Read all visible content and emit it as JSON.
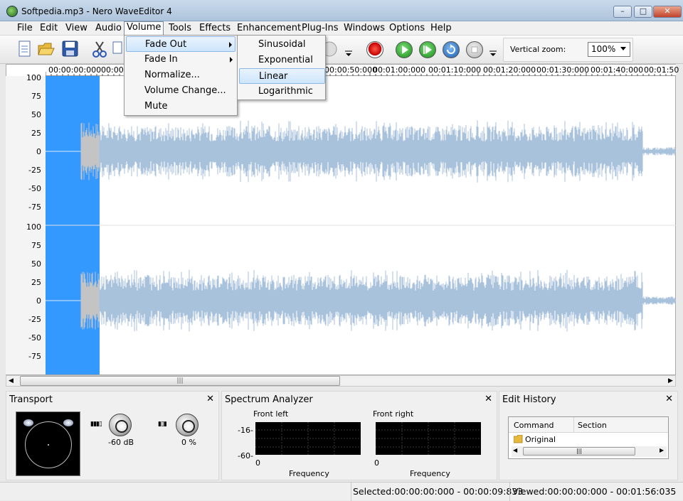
{
  "window": {
    "title": "Softpedia.mp3 - Nero WaveEditor 4",
    "controls": {
      "minimize": "–",
      "maximize": "□",
      "close": "✕"
    }
  },
  "menubar": [
    "File",
    "Edit",
    "View",
    "Audio",
    "Volume",
    "Tools",
    "Effects",
    "Enhancement",
    "Plug-Ins",
    "Windows",
    "Options",
    "Help"
  ],
  "volume_menu": {
    "items": [
      "Fade Out",
      "Fade In",
      "Normalize...",
      "Volume Change...",
      "Mute"
    ],
    "highlighted": "Fade Out"
  },
  "fade_out_submenu": {
    "items": [
      "Sinusoidal",
      "Exponential",
      "Linear",
      "Logarithmic"
    ],
    "highlighted": "Linear"
  },
  "toolbar": {
    "vertical_zoom_label": "Vertical zoom:",
    "vertical_zoom_value": "100%"
  },
  "ruler": {
    "ticks": [
      "00:00:00:000",
      "00:00",
      "00:00:50:000",
      "00:01:00:000",
      "00:01:10:000",
      "00:01:20:000",
      "00:01:30:000",
      "00:01:40:000",
      "00:01:50"
    ]
  },
  "yaxis": {
    "channel1": [
      "100",
      "75",
      "50",
      "25",
      "0",
      "-25",
      "-50",
      "-75"
    ],
    "channel2": [
      "100",
      "75",
      "50",
      "25",
      "0",
      "-25",
      "-50",
      "-75"
    ]
  },
  "transport": {
    "title": "Transport",
    "volume_value": "-60 dB",
    "balance_value": "0 %"
  },
  "spectrum": {
    "title": "Spectrum Analyzer",
    "front_left": "Front left",
    "front_right": "Front right",
    "y_top": "-16-",
    "y_bottom": "-60-",
    "x_zero": "0",
    "x_label": "Frequency"
  },
  "history": {
    "title": "Edit History",
    "columns": [
      "Command",
      "Section"
    ],
    "rows": [
      "Original"
    ]
  },
  "status": {
    "selected": "Selected:00:00:00:000 - 00:00:09:833",
    "viewed": "Viewed:00:00:00:000 - 00:01:56:035"
  },
  "colors": {
    "waveform": "#a9c2dc",
    "selection": "#3399ff",
    "spectrum_bg": "#000000"
  }
}
